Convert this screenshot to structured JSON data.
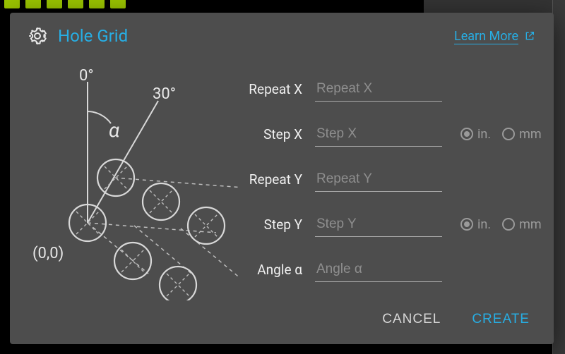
{
  "header": {
    "title": "Hole Grid",
    "learn_more_label": "Learn More"
  },
  "diagram": {
    "zero_deg": "0°",
    "thirty_deg": "30°",
    "alpha": "α",
    "origin": "(0,0)"
  },
  "form": {
    "repeat_x": {
      "label": "Repeat X",
      "placeholder": "Repeat X",
      "value": ""
    },
    "step_x": {
      "label": "Step X",
      "placeholder": "Step X",
      "value": ""
    },
    "repeat_y": {
      "label": "Repeat Y",
      "placeholder": "Repeat Y",
      "value": ""
    },
    "step_y": {
      "label": "Step Y",
      "placeholder": "Step Y",
      "value": ""
    },
    "angle": {
      "label": "Angle α",
      "placeholder": "Angle α",
      "value": ""
    },
    "units": {
      "in_label": "in.",
      "mm_label": "mm",
      "step_x_selected": "in",
      "step_y_selected": "in"
    }
  },
  "footer": {
    "cancel": "CANCEL",
    "create": "CREATE"
  },
  "bg": {
    "top_right_hint": ""
  },
  "colors": {
    "accent": "#27aee4",
    "panel": "#4d4d4d"
  }
}
